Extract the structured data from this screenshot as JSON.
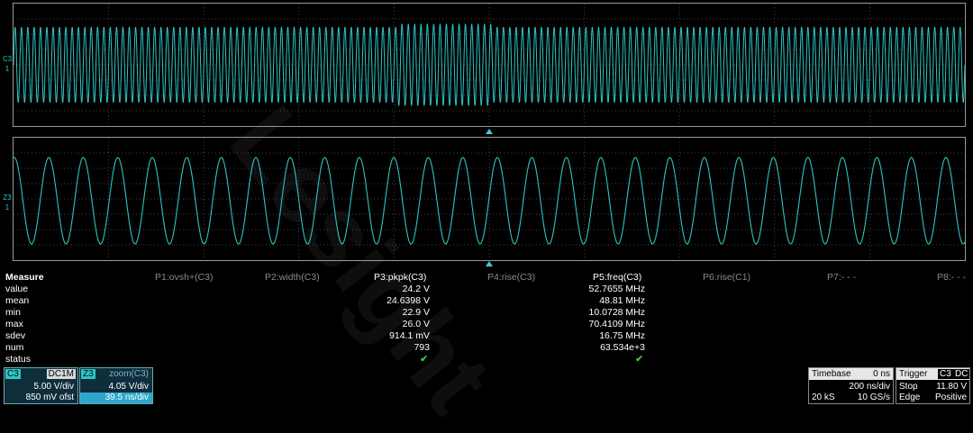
{
  "top_grid": {
    "trace_label": "C3",
    "trace_level": "1"
  },
  "bottom_grid": {
    "trace_label": "Z3",
    "trace_level": "1"
  },
  "watermark": "Lesight",
  "measure": {
    "title": "Measure",
    "row_labels": [
      "value",
      "mean",
      "min",
      "max",
      "sdev",
      "num",
      "status"
    ],
    "params": [
      {
        "header": "P1:ovsh+(C3)"
      },
      {
        "header": "P2:width(C3)"
      },
      {
        "header": "P3:pkpk(C3)",
        "values": [
          "24.2 V",
          "24.6398 V",
          "22.9 V",
          "26.0 V",
          "914.1 mV",
          "793",
          "✔"
        ]
      },
      {
        "header": "P4:rise(C3)"
      },
      {
        "header": "P5:freq(C3)",
        "values": [
          "52.7655 MHz",
          "48.81 MHz",
          "10.0728 MHz",
          "70.4109 MHz",
          "16.75 MHz",
          "63.534e+3",
          "✔"
        ]
      },
      {
        "header": "P6:rise(C1)"
      },
      {
        "header": "P7:- - -"
      },
      {
        "header": "P8:- - -"
      }
    ]
  },
  "c3_box": {
    "name": "C3",
    "coupling": "DC1M",
    "vdiv": "5.00 V/div",
    "offset": "850 mV ofst"
  },
  "z3_box": {
    "name": "Z3",
    "source": "zoom(C3)",
    "vdiv": "4.05 V/div",
    "tdiv": "39.5 ns/div"
  },
  "timebase": {
    "label": "Timebase",
    "delay": "0 ns",
    "tdiv": "200 ns/div",
    "samples": "20 kS",
    "rate": "10 GS/s"
  },
  "trigger": {
    "label": "Trigger",
    "source": "C3",
    "coupling": "DC",
    "mode": "Stop",
    "level": "11.80 V",
    "type": "Edge",
    "slope": "Positive"
  },
  "colors": {
    "trace": "#2ec4c4",
    "grid": "#5a5a5a",
    "background": "#000000",
    "check": "#2ed12e"
  }
}
